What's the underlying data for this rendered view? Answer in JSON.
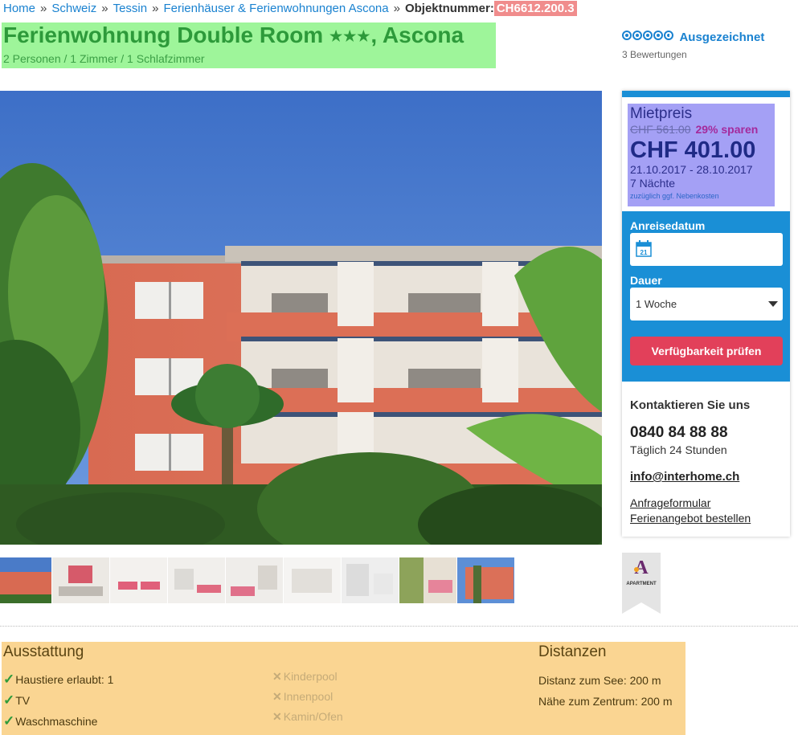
{
  "breadcrumb": {
    "items": [
      "Home",
      "Schweiz",
      "Tessin",
      "Ferienhäuser & Ferienwohnungen Ascona"
    ],
    "separator": "»",
    "object_label": "Objektnummer:",
    "object_number": "CH6612.200.3"
  },
  "listing": {
    "title_main": "Ferienwohnung Double Room",
    "stars": "★★★",
    "title_location": ", Ascona",
    "subtitle": "2 Personen / 1 Zimmer / 1 Schlafzimmer"
  },
  "rating": {
    "label": "Ausgezeichnet",
    "reviews": "3 Bewertungen",
    "score_out_of_5": 4.5
  },
  "price": {
    "heading": "Mietpreis",
    "old_price": "CHF 561.00",
    "savings": "29% sparen",
    "current_price": "CHF 401.00",
    "dates": "21.10.2017 - 28.10.2017",
    "nights": "7 Nächte",
    "extra_costs": "zuzüglich ggf. Nebenkosten"
  },
  "booking": {
    "arrival_label": "Anreisedatum",
    "calendar_icon_day": "21",
    "duration_label": "Dauer",
    "duration_value": "1 Woche",
    "check_button": "Verfügbarkeit prüfen"
  },
  "contact": {
    "heading": "Kontaktieren Sie uns",
    "phone": "0840 84 88 88",
    "hours": "Täglich 24 Stunden",
    "email": "info@interhome.ch",
    "form_link": "Anfrageformular",
    "offer_link": "Ferienangebot bestellen"
  },
  "badge": {
    "text": "APARTMENT",
    "letter": "A"
  },
  "amenities": {
    "heading": "Ausstattung",
    "available": [
      "Haustiere erlaubt: 1",
      "TV",
      "Waschmaschine"
    ],
    "unavailable": [
      "Kinderpool",
      "Innenpool",
      "Kamin/Ofen"
    ],
    "check_symbol": "✓",
    "cross_symbol": "✕"
  },
  "distances": {
    "heading": "Distanzen",
    "items": [
      "Distanz zum See: 200 m",
      "Nähe zum Zentrum: 200 m"
    ]
  },
  "colors": {
    "link": "#1a82d0",
    "title_green": "#2d9a3a",
    "booking_blue": "#1a8fd6",
    "button_red": "#e2405a"
  }
}
